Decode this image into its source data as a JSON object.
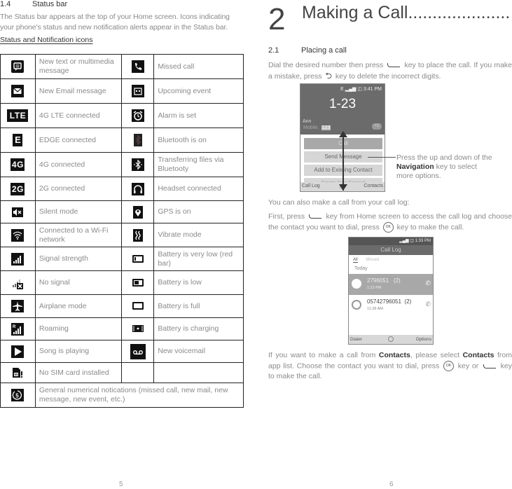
{
  "left_page": {
    "section_number": "1.4",
    "section_title": "Status bar",
    "intro": "The Status bar appears at the top of your Home screen. Icons indicating your phone's status and new notification alerts appear in the Status bar.",
    "subtitle": "Status and Notification icons",
    "rows": [
      {
        "left_icon": "message-icon",
        "left_label": "New text or multimedia message",
        "right_icon": "missed-call-icon",
        "right_label": "Missed call"
      },
      {
        "left_icon": "email-icon",
        "left_label": "New Email message",
        "right_icon": "calendar-icon",
        "right_label": "Upcoming event"
      },
      {
        "left_icon": "lte-icon",
        "left_label": "4G LTE connected",
        "right_icon": "alarm-icon",
        "right_label": "Alarm is set"
      },
      {
        "left_icon": "edge-icon",
        "left_label": "EDGE connected",
        "right_icon": "bluetooth-icon",
        "right_label": "Bluetooth is on"
      },
      {
        "left_icon": "4g-icon",
        "left_label": "4G connected",
        "right_icon": "bluetooth-transfer-icon",
        "right_label": "Transferring files via Bluetooty"
      },
      {
        "left_icon": "2g-icon",
        "left_label": "2G connected",
        "right_icon": "headset-icon",
        "right_label": "Headset connected"
      },
      {
        "left_icon": "silent-icon",
        "left_label": "Silent mode",
        "right_icon": "gps-icon",
        "right_label": "GPS is on"
      },
      {
        "left_icon": "wifi-icon",
        "left_label": "Connected to a Wi-Fi network",
        "right_icon": "vibrate-icon",
        "right_label": "Vibrate mode"
      },
      {
        "left_icon": "signal-icon",
        "left_label": "Signal strength",
        "right_icon": "battery-very-low-icon",
        "right_label": "Battery is very low (red bar)"
      },
      {
        "left_icon": "no-signal-icon",
        "left_label": "No signal",
        "right_icon": "battery-low-icon",
        "right_label": "Battery is low"
      },
      {
        "left_icon": "airplane-icon",
        "left_label": "Airplane mode",
        "right_icon": "battery-full-icon",
        "right_label": "Battery is full"
      },
      {
        "left_icon": "roaming-icon",
        "left_label": "Roaming",
        "right_icon": "battery-charging-icon",
        "right_label": "Battery is charging"
      },
      {
        "left_icon": "play-icon",
        "left_label": "Song is playing",
        "right_icon": "voicemail-icon",
        "right_label": "New voicemail"
      },
      {
        "left_icon": "no-sim-icon",
        "left_label": "No SIM card installed",
        "right_icon": "",
        "right_label": ""
      },
      {
        "left_icon": "numerical-notification-icon",
        "left_label": "General numerical notications (missed call, new mail, new message, new event, etc.)"
      }
    ],
    "icon_glyphs": {
      "lte": "LTE",
      "edge": "E",
      "4g": "4G",
      "2g": "2G",
      "roaming_r": "R",
      "numeric": "5"
    },
    "page_number": "5"
  },
  "right_page": {
    "chapter_number": "2",
    "chapter_title": "Making a Call.....................",
    "section_number": "2.1",
    "section_title": "Placing a call",
    "para1_a": "Dial the desired number then press",
    "para1_b": "key to place the call. If you make a mistake, press",
    "para1_c": "key to delete the incorrect digits.",
    "phone1": {
      "status": "E ▂▄▆ ◫ 3:41 PM",
      "dialed_number": "1-23",
      "contact_name": "Ann",
      "contact_type": "Mobile,",
      "contact_match": "123",
      "badge": "+1",
      "options": [
        "Call",
        "Send Message",
        "Add to Existing Contact",
        "Create New Contact"
      ],
      "softkey_left": "Call Log",
      "softkey_center": "◯",
      "softkey_right": "Contacts"
    },
    "callout_a": "Press the up and down of the",
    "callout_bold": "Navigation",
    "callout_b": "key to select more options.",
    "para2": "You can also make a call from your call log:",
    "para3_a": "First, press",
    "para3_b": "key from Home screen to access the call log and choose the contact you want to dial, press",
    "para3_c": "key to make the call.",
    "ok_key_label": "OK",
    "phone2": {
      "status": "▂▄▆ ◫ 1:33 PM",
      "title": "Call Log",
      "tabs": [
        "All",
        "Missed"
      ],
      "group": "Today",
      "entries": [
        {
          "number": "2796051",
          "count": "(2)",
          "time": "1:23 PM",
          "selected": true
        },
        {
          "number": "05742796051",
          "count": "(2)",
          "time": "11:28 AM",
          "selected": false
        }
      ],
      "softkey_left": "Dialer",
      "softkey_right": "Options"
    },
    "para4_a": "If you want to make a call from",
    "para4_bold1": "Contacts",
    "para4_b": ", please select",
    "para4_bold2": "Contacts",
    "para4_c": "from app list. Choose the contact you want to dial, press",
    "para4_d": "key or",
    "para4_e": "key to make the call.",
    "page_number": "6"
  }
}
